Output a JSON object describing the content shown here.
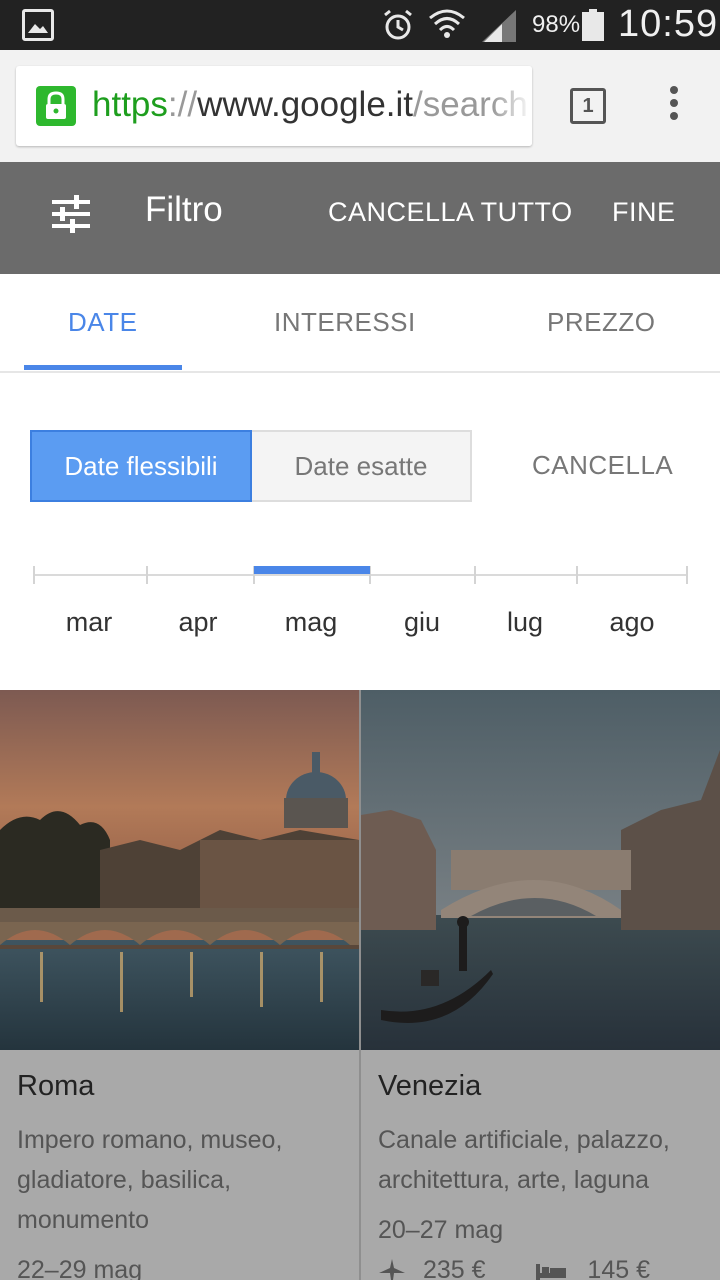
{
  "status_bar": {
    "battery": "98%",
    "time": "10:59",
    "icons": [
      "image-notification-icon",
      "alarm-icon",
      "wifi-icon",
      "signal-icon",
      "battery-icon"
    ]
  },
  "browser": {
    "url_scheme": "https",
    "url_sep": "://",
    "url_domain": "www.google.it",
    "url_path": "/search",
    "tab_count": "1"
  },
  "filter_header": {
    "title": "Filtro",
    "clear_all": "CANCELLA TUTTO",
    "done": "FINE"
  },
  "tabs": [
    {
      "label": "DATE",
      "active": true
    },
    {
      "label": "INTERESSI",
      "active": false
    },
    {
      "label": "PREZZO",
      "active": false
    }
  ],
  "date_mode": {
    "flexible": "Date flessibili",
    "exact": "Date esatte",
    "selected": "Date flessibili",
    "cancel": "CANCELLA"
  },
  "months": [
    "mar",
    "apr",
    "mag",
    "giu",
    "lug",
    "ago"
  ],
  "selected_month": "mag",
  "colors": {
    "accent": "#4a86e8",
    "header_bg": "#6b6b6b",
    "card_body_bg": "#a9a9a9",
    "lock_green": "#2eb82e"
  },
  "destinations": [
    {
      "name": "Roma",
      "description": "Impero romano, museo, gladiatore, basilica, monumento",
      "dates": "22–29 mag"
    },
    {
      "name": "Venezia",
      "description": "Canale artificiale, palazzo, architettura, arte, laguna",
      "dates": "20–27 mag",
      "flight_price": "235 €",
      "hotel_price": "145 €"
    }
  ]
}
